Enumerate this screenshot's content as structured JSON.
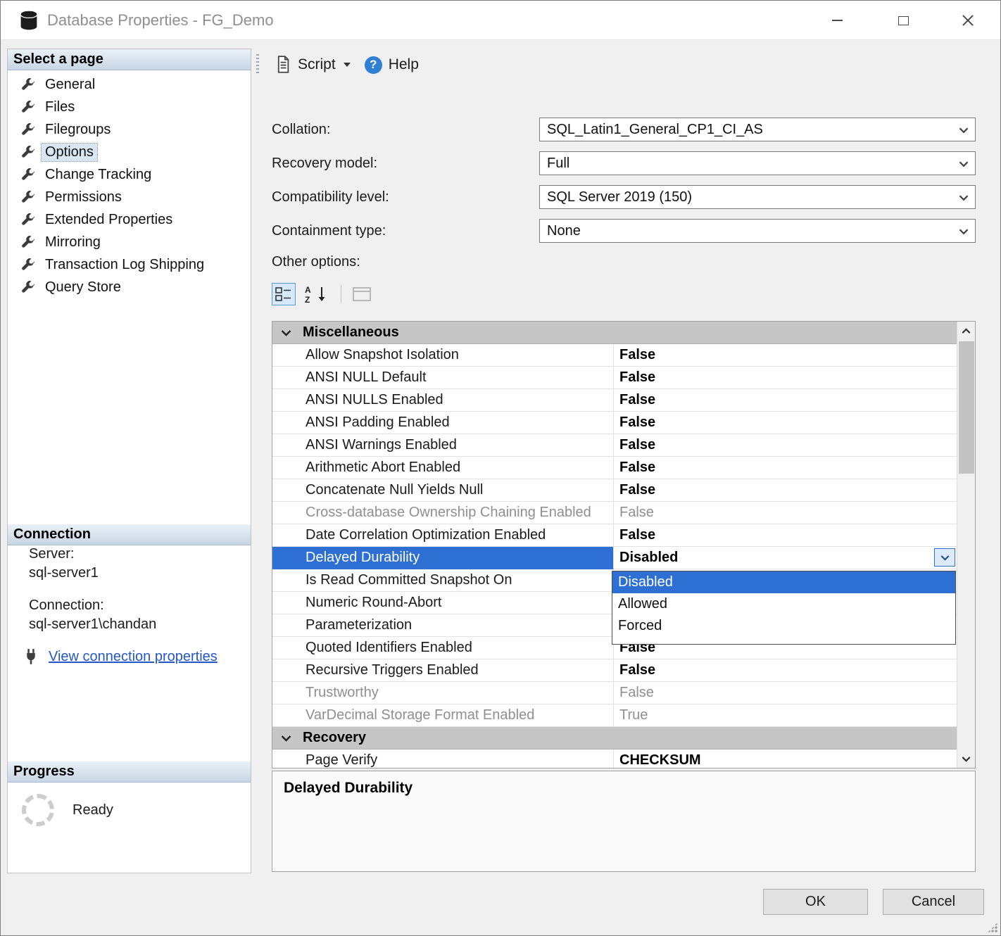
{
  "window": {
    "title": "Database Properties - FG_Demo"
  },
  "toolbar": {
    "script_label": "Script",
    "help_label": "Help",
    "help_glyph": "?"
  },
  "sidebar": {
    "header": "Select a page",
    "selected": "Options",
    "items": [
      {
        "label": "General"
      },
      {
        "label": "Files"
      },
      {
        "label": "Filegroups"
      },
      {
        "label": "Options"
      },
      {
        "label": "Change Tracking"
      },
      {
        "label": "Permissions"
      },
      {
        "label": "Extended Properties"
      },
      {
        "label": "Mirroring"
      },
      {
        "label": "Transaction Log Shipping"
      },
      {
        "label": "Query Store"
      }
    ]
  },
  "connection": {
    "header": "Connection",
    "server_label": "Server:",
    "server_value": "sql-server1",
    "connection_label": "Connection:",
    "connection_value": "sql-server1\\chandan",
    "link_label": "View connection properties"
  },
  "progress": {
    "header": "Progress",
    "status": "Ready"
  },
  "form": {
    "collation_label": "Collation:",
    "collation_value": "SQL_Latin1_General_CP1_CI_AS",
    "recovery_label": "Recovery model:",
    "recovery_value": "Full",
    "compat_label": "Compatibility level:",
    "compat_value": "SQL Server 2019 (150)",
    "containment_label": "Containment type:",
    "containment_value": "None",
    "other_options_label": "Other options:"
  },
  "grid": {
    "misc_header": "Miscellaneous",
    "recovery_header": "Recovery",
    "rows": [
      {
        "name": "Allow Snapshot Isolation",
        "value": "False"
      },
      {
        "name": "ANSI NULL Default",
        "value": "False"
      },
      {
        "name": "ANSI NULLS Enabled",
        "value": "False"
      },
      {
        "name": "ANSI Padding Enabled",
        "value": "False"
      },
      {
        "name": "ANSI Warnings Enabled",
        "value": "False"
      },
      {
        "name": "Arithmetic Abort Enabled",
        "value": "False"
      },
      {
        "name": "Concatenate Null Yields Null",
        "value": "False"
      },
      {
        "name": "Cross-database Ownership Chaining Enabled",
        "value": "False"
      },
      {
        "name": "Date Correlation Optimization Enabled",
        "value": "False"
      },
      {
        "name": "Delayed Durability",
        "value": "Disabled"
      },
      {
        "name": "Is Read Committed Snapshot On",
        "value": ""
      },
      {
        "name": "Numeric Round-Abort",
        "value": ""
      },
      {
        "name": "Parameterization",
        "value": ""
      },
      {
        "name": "Quoted Identifiers Enabled",
        "value": "False"
      },
      {
        "name": "Recursive Triggers Enabled",
        "value": "False"
      },
      {
        "name": "Trustworthy",
        "value": "False"
      },
      {
        "name": "VarDecimal Storage Format Enabled",
        "value": "True"
      }
    ],
    "recovery_rows": [
      {
        "name": "Page Verify",
        "value": "CHECKSUM"
      }
    ]
  },
  "dropdown": {
    "selected": "Disabled",
    "options": [
      "Disabled",
      "Allowed",
      "Forced"
    ]
  },
  "description": {
    "title": "Delayed Durability"
  },
  "footer": {
    "ok_label": "OK",
    "cancel_label": "Cancel"
  },
  "icons": {
    "title": "database-icon",
    "sidebar_item": "wrench-icon",
    "link": "connection-properties-icon",
    "toolbar": [
      "script-icon",
      "dropdown-caret-icon",
      "help-icon"
    ],
    "mini_toolbar": [
      "categorized-icon",
      "sort-alphabetical-icon",
      "property-pages-icon"
    ]
  },
  "colors": {
    "selection_blue": "#2e6fd4",
    "link_blue": "#2457c9",
    "help_blue": "#2f7fd6",
    "category_gray": "#c6c6c6"
  }
}
